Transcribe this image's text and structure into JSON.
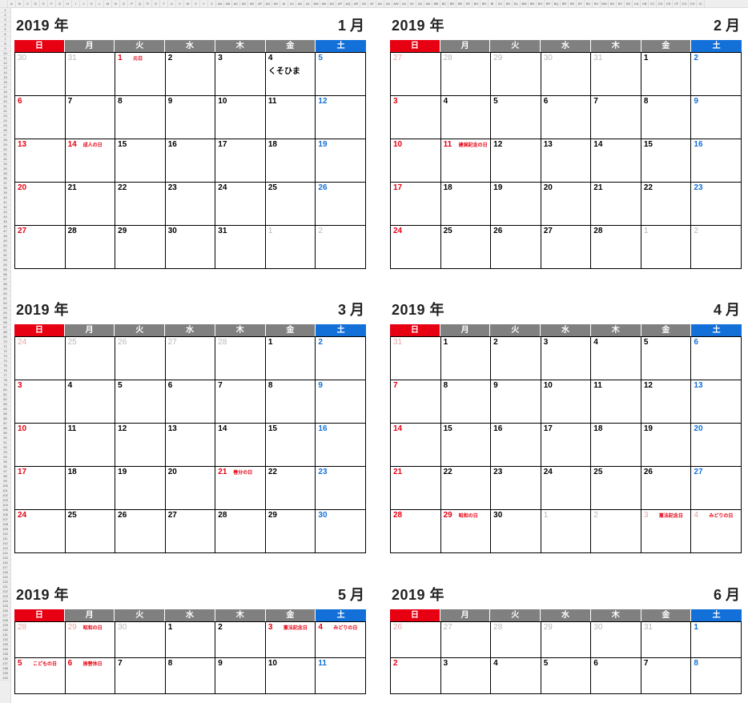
{
  "year_label_suffix": "年",
  "month_label_suffix": "月",
  "dow": [
    "日",
    "月",
    "火",
    "水",
    "木",
    "金",
    "土"
  ],
  "spreadsheet_columns": [
    "",
    "A",
    "B",
    "C",
    "D",
    "E",
    "F",
    "G",
    "H",
    "I",
    "J",
    "K",
    "L",
    "M",
    "N",
    "O",
    "P",
    "Q",
    "R",
    "S",
    "T",
    "U",
    "V",
    "W",
    "X",
    "Y",
    "Z",
    "AA",
    "AB",
    "AC",
    "AD",
    "AE",
    "AF",
    "AG",
    "AH",
    "AI",
    "AJ",
    "AK",
    "AL",
    "AM",
    "AN",
    "AO",
    "AP",
    "AQ",
    "AR",
    "AS",
    "AT",
    "AU",
    "AV",
    "AW",
    "AX",
    "AY",
    "AZ",
    "BA",
    "BB",
    "BC",
    "BD",
    "BE",
    "BF",
    "BG",
    "BH",
    "BI",
    "BJ",
    "BK",
    "BL",
    "BM",
    "BN",
    "BO",
    "BP",
    "BQ",
    "BR",
    "BS",
    "BT",
    "BU",
    "BV",
    "BW",
    "BX",
    "BY",
    "BZ",
    "CA",
    "CB",
    "CC",
    "CD",
    "CE",
    "CF",
    "CG",
    "CH",
    "CI"
  ],
  "calendars": [
    {
      "year": "2019",
      "month": "1",
      "rows": 5,
      "cells": [
        {
          "n": "30",
          "cls": "other"
        },
        {
          "n": "31",
          "cls": "other"
        },
        {
          "n": "1",
          "cls": "holiday",
          "h": "元日"
        },
        {
          "n": "2"
        },
        {
          "n": "3"
        },
        {
          "n": "4",
          "note": "くそひま"
        },
        {
          "n": "5",
          "cls": "sat"
        },
        {
          "n": "6",
          "cls": "sun"
        },
        {
          "n": "7"
        },
        {
          "n": "8"
        },
        {
          "n": "9"
        },
        {
          "n": "10"
        },
        {
          "n": "11"
        },
        {
          "n": "12",
          "cls": "sat"
        },
        {
          "n": "13",
          "cls": "sun"
        },
        {
          "n": "14",
          "cls": "holiday",
          "h": "成人の日"
        },
        {
          "n": "15"
        },
        {
          "n": "16"
        },
        {
          "n": "17"
        },
        {
          "n": "18"
        },
        {
          "n": "19",
          "cls": "sat"
        },
        {
          "n": "20",
          "cls": "sun"
        },
        {
          "n": "21"
        },
        {
          "n": "22"
        },
        {
          "n": "23"
        },
        {
          "n": "24"
        },
        {
          "n": "25"
        },
        {
          "n": "26",
          "cls": "sat"
        },
        {
          "n": "27",
          "cls": "sun"
        },
        {
          "n": "28"
        },
        {
          "n": "29"
        },
        {
          "n": "30"
        },
        {
          "n": "31"
        },
        {
          "n": "1",
          "cls": "other"
        },
        {
          "n": "2",
          "cls": "other"
        }
      ]
    },
    {
      "year": "2019",
      "month": "2",
      "rows": 5,
      "cells": [
        {
          "n": "27",
          "cls": "other red"
        },
        {
          "n": "28",
          "cls": "other"
        },
        {
          "n": "29",
          "cls": "other"
        },
        {
          "n": "30",
          "cls": "other"
        },
        {
          "n": "31",
          "cls": "other"
        },
        {
          "n": "1"
        },
        {
          "n": "2",
          "cls": "sat"
        },
        {
          "n": "3",
          "cls": "sun"
        },
        {
          "n": "4"
        },
        {
          "n": "5"
        },
        {
          "n": "6"
        },
        {
          "n": "7"
        },
        {
          "n": "8"
        },
        {
          "n": "9",
          "cls": "sat"
        },
        {
          "n": "10",
          "cls": "sun"
        },
        {
          "n": "11",
          "cls": "holiday",
          "h": "建国記念の日"
        },
        {
          "n": "12"
        },
        {
          "n": "13"
        },
        {
          "n": "14"
        },
        {
          "n": "15"
        },
        {
          "n": "16",
          "cls": "sat"
        },
        {
          "n": "17",
          "cls": "sun"
        },
        {
          "n": "18"
        },
        {
          "n": "19"
        },
        {
          "n": "20"
        },
        {
          "n": "21"
        },
        {
          "n": "22"
        },
        {
          "n": "23",
          "cls": "sat"
        },
        {
          "n": "24",
          "cls": "sun"
        },
        {
          "n": "25"
        },
        {
          "n": "26"
        },
        {
          "n": "27"
        },
        {
          "n": "28"
        },
        {
          "n": "1",
          "cls": "other"
        },
        {
          "n": "2",
          "cls": "other"
        }
      ]
    },
    {
      "year": "2019",
      "month": "3",
      "rows": 5,
      "cells": [
        {
          "n": "24",
          "cls": "other red"
        },
        {
          "n": "25",
          "cls": "other"
        },
        {
          "n": "26",
          "cls": "other"
        },
        {
          "n": "27",
          "cls": "other"
        },
        {
          "n": "28",
          "cls": "other"
        },
        {
          "n": "1"
        },
        {
          "n": "2",
          "cls": "sat"
        },
        {
          "n": "3",
          "cls": "sun"
        },
        {
          "n": "4"
        },
        {
          "n": "5"
        },
        {
          "n": "6"
        },
        {
          "n": "7"
        },
        {
          "n": "8"
        },
        {
          "n": "9",
          "cls": "sat"
        },
        {
          "n": "10",
          "cls": "sun"
        },
        {
          "n": "11"
        },
        {
          "n": "12"
        },
        {
          "n": "13"
        },
        {
          "n": "14"
        },
        {
          "n": "15"
        },
        {
          "n": "16",
          "cls": "sat"
        },
        {
          "n": "17",
          "cls": "sun"
        },
        {
          "n": "18"
        },
        {
          "n": "19"
        },
        {
          "n": "20"
        },
        {
          "n": "21",
          "cls": "holiday",
          "h": "春分の日"
        },
        {
          "n": "22"
        },
        {
          "n": "23",
          "cls": "sat"
        },
        {
          "n": "24",
          "cls": "sun"
        },
        {
          "n": "25"
        },
        {
          "n": "26"
        },
        {
          "n": "27"
        },
        {
          "n": "28"
        },
        {
          "n": "29"
        },
        {
          "n": "30",
          "cls": "sat"
        }
      ]
    },
    {
      "year": "2019",
      "month": "4",
      "rows": 5,
      "cells": [
        {
          "n": "31",
          "cls": "other red"
        },
        {
          "n": "1"
        },
        {
          "n": "2"
        },
        {
          "n": "3"
        },
        {
          "n": "4"
        },
        {
          "n": "5"
        },
        {
          "n": "6",
          "cls": "sat"
        },
        {
          "n": "7",
          "cls": "sun"
        },
        {
          "n": "8"
        },
        {
          "n": "9"
        },
        {
          "n": "10"
        },
        {
          "n": "11"
        },
        {
          "n": "12"
        },
        {
          "n": "13",
          "cls": "sat"
        },
        {
          "n": "14",
          "cls": "sun"
        },
        {
          "n": "15"
        },
        {
          "n": "16"
        },
        {
          "n": "17"
        },
        {
          "n": "18"
        },
        {
          "n": "19"
        },
        {
          "n": "20",
          "cls": "sat"
        },
        {
          "n": "21",
          "cls": "sun"
        },
        {
          "n": "22"
        },
        {
          "n": "23"
        },
        {
          "n": "24"
        },
        {
          "n": "25"
        },
        {
          "n": "26"
        },
        {
          "n": "27",
          "cls": "sat"
        },
        {
          "n": "28",
          "cls": "sun"
        },
        {
          "n": "29",
          "cls": "holiday",
          "h": "昭和の日"
        },
        {
          "n": "30"
        },
        {
          "n": "1",
          "cls": "other"
        },
        {
          "n": "2",
          "cls": "other"
        },
        {
          "n": "3",
          "cls": "other red",
          "h": "憲法記念日"
        },
        {
          "n": "4",
          "cls": "other red",
          "h": "みどりの日"
        }
      ]
    },
    {
      "year": "2019",
      "month": "5",
      "rows": 2,
      "cells": [
        {
          "n": "28",
          "cls": "other red"
        },
        {
          "n": "29",
          "cls": "other red",
          "h": "昭和の日"
        },
        {
          "n": "30",
          "cls": "other"
        },
        {
          "n": "1"
        },
        {
          "n": "2"
        },
        {
          "n": "3",
          "cls": "holiday",
          "h": "憲法記念日"
        },
        {
          "n": "4",
          "cls": "holiday",
          "h": "みどりの日"
        },
        {
          "n": "5",
          "cls": "holiday",
          "h": "こどもの日"
        },
        {
          "n": "6",
          "cls": "holiday",
          "h": "振替休日"
        },
        {
          "n": "7"
        },
        {
          "n": "8"
        },
        {
          "n": "9"
        },
        {
          "n": "10"
        },
        {
          "n": "11",
          "cls": "sat"
        }
      ]
    },
    {
      "year": "2019",
      "month": "6",
      "rows": 2,
      "cells": [
        {
          "n": "26",
          "cls": "other red"
        },
        {
          "n": "27",
          "cls": "other"
        },
        {
          "n": "28",
          "cls": "other"
        },
        {
          "n": "29",
          "cls": "other"
        },
        {
          "n": "30",
          "cls": "other"
        },
        {
          "n": "31",
          "cls": "other"
        },
        {
          "n": "1",
          "cls": "sat"
        },
        {
          "n": "2",
          "cls": "sun"
        },
        {
          "n": "3"
        },
        {
          "n": "4"
        },
        {
          "n": "5"
        },
        {
          "n": "6"
        },
        {
          "n": "7"
        },
        {
          "n": "8",
          "cls": "sat"
        }
      ]
    }
  ]
}
